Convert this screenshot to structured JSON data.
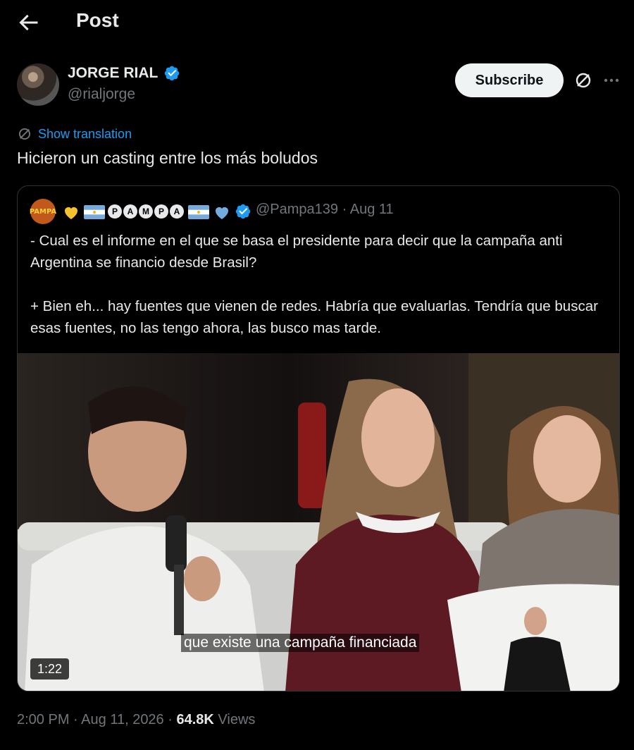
{
  "header": {
    "title": "Post"
  },
  "author": {
    "name": "JORGE RIAL",
    "handle": "@rialjorge",
    "subscribe_label": "Subscribe"
  },
  "post": {
    "translate_label": "Show translation",
    "text": "Hicieron un casting entre los más boludos"
  },
  "quoted": {
    "avatar_text": "PAMPA",
    "display_name_letters": [
      "P",
      "A",
      "M",
      "P",
      "A"
    ],
    "handle": "@Pampa139",
    "date": "Aug 11",
    "body": [
      "- Cual es el informe en el que se basa el presidente para decir que la campaña anti Argentina se financio desde Brasil?",
      "+ Bien eh... hay fuentes que vienen de redes. Habría que evaluarlas. Tendría que buscar esas fuentes, no las tengo ahora, las busco mas tarde."
    ],
    "video": {
      "caption": "que existe una campaña financiada",
      "duration": "1:22"
    }
  },
  "meta": {
    "time": "2:00 PM",
    "date": "Aug 11, 2026",
    "views_count": "64.8K",
    "views_label": "Views"
  },
  "colors": {
    "accent": "#1d9bf0",
    "background": "#000000",
    "text": "#e7e9ea",
    "muted": "#71767b"
  }
}
